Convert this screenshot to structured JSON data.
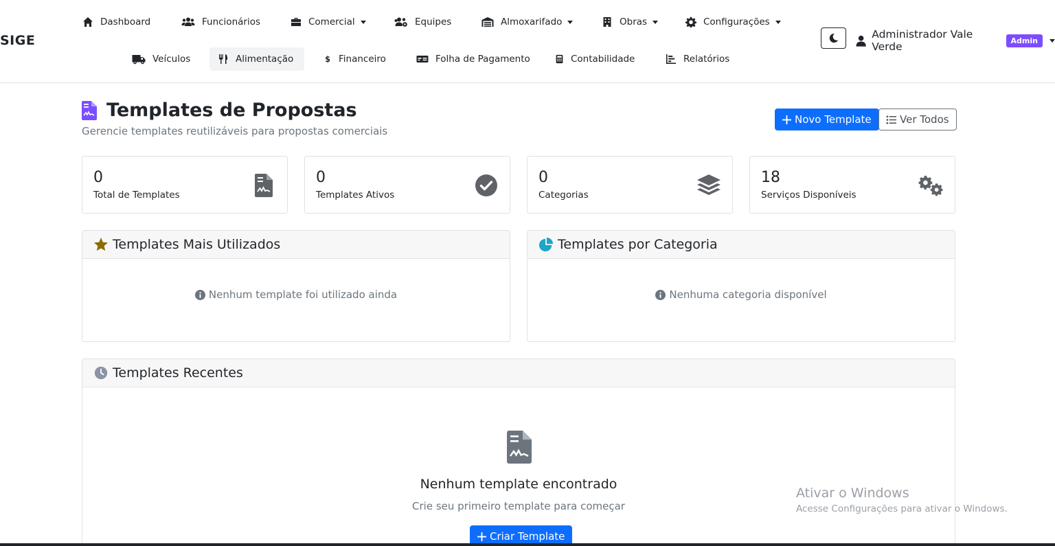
{
  "brand": "SIGE",
  "nav": {
    "row1": [
      {
        "label": "Dashboard",
        "icon": "home-icon",
        "dropdown": false
      },
      {
        "label": "Funcionários",
        "icon": "users-icon",
        "dropdown": false
      },
      {
        "label": "Comercial",
        "icon": "briefcase-icon",
        "dropdown": true
      },
      {
        "label": "Equipes",
        "icon": "users-cog-icon",
        "dropdown": false
      },
      {
        "label": "Almoxarifado",
        "icon": "warehouse-icon",
        "dropdown": true
      },
      {
        "label": "Obras",
        "icon": "building-icon",
        "dropdown": true
      },
      {
        "label": "Configurações",
        "icon": "gear-icon",
        "dropdown": true
      }
    ],
    "row2": [
      {
        "label": "Veículos",
        "icon": "truck-icon"
      },
      {
        "label": "Alimentação",
        "icon": "utensils-icon",
        "active": true
      },
      {
        "label": "Financeiro",
        "icon": "dollar-icon"
      },
      {
        "label": "Folha de Pagamento",
        "icon": "money-check-icon"
      },
      {
        "label": "Contabilidade",
        "icon": "calculator-icon"
      },
      {
        "label": "Relatórios",
        "icon": "chart-bar-icon"
      }
    ]
  },
  "user": {
    "name": "Administrador Vale Verde",
    "badge": "Admin"
  },
  "header": {
    "title": "Templates de Propostas",
    "subtitle": "Gerencie templates reutilizáveis para propostas comerciais",
    "new_button": "Novo Template",
    "view_all_button": "Ver Todos"
  },
  "stats": [
    {
      "value": "0",
      "label": "Total de Templates",
      "icon": "file-contract-icon"
    },
    {
      "value": "0",
      "label": "Templates Ativos",
      "icon": "check-circle-icon"
    },
    {
      "value": "0",
      "label": "Categorias",
      "icon": "layers-icon"
    },
    {
      "value": "18",
      "label": "Serviços Disponíveis",
      "icon": "gears-icon"
    }
  ],
  "panels": {
    "most_used": {
      "title": "Templates Mais Utilizados",
      "empty": "Nenhum template foi utilizado ainda"
    },
    "by_category": {
      "title": "Templates por Categoria",
      "empty": "Nenhuma categoria disponível"
    },
    "recent": {
      "title": "Templates Recentes",
      "empty_title": "Nenhum template encontrado",
      "empty_sub": "Crie seu primeiro template para começar",
      "create_button": "Criar Template"
    }
  },
  "watermark": {
    "title": "Ativar o Windows",
    "sub": "Acesse Configurações para ativar o Windows."
  },
  "colors": {
    "primary": "#0d6efd",
    "admin_badge": "#7c4dff",
    "title_icon": "#7c4dff",
    "star": "#8a6d00",
    "pie": "#1ca7c6"
  }
}
